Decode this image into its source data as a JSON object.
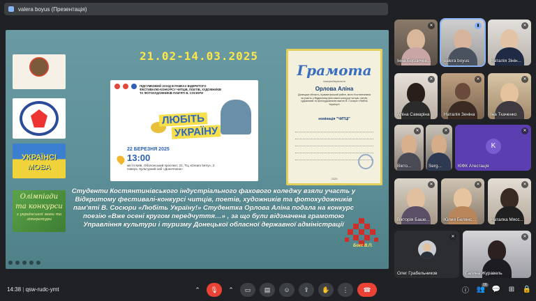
{
  "topbar": {
    "presenter_label": "valera boyus (Презентація)"
  },
  "slide": {
    "date_range": "21.02-14.03.2025",
    "logos": {
      "ukr_line1": "УКРАЇНСІ",
      "ukr_line2": "МОВА",
      "olymp_line1": "Олімпіади",
      "olymp_line2": "та конкурси",
      "olymp_line3": "з української мови та літератури"
    },
    "poster": {
      "header": "ПІДСУМКОВИЙ ЗАХІД В РАМКАХ ВІДКРИТОГО ФЕСТИВАЛЮ-КОНКУРСУ ЧИТЦІВ, ПОЕТІВ, ХУДОЖНИКІВ ТА ФОТОХУДОЖНИКІВ ПАМ'ЯТІ В. СОСЮРИ",
      "title1": "ЛЮБІТЬ",
      "title2": "УКРАЇНУ",
      "date": "22 БЕРЕЗНЯ 2025",
      "time": "13:00",
      "address": "місто Київ, Оболонський проспект, 21, ТЦ «Dream berry», 2 поверх, Культурний хаб «Донеччина»"
    },
    "certificate": {
      "title": "Грамота",
      "awarded": "нагороджується",
      "name": "Орлова Аліна",
      "body": "Донецька область, Краматорський район, місто Костянтинівка за участь у Відкритому фестивалі-конкурсі читців, поетів, художників та фотохудожників пам'яті В. Сосюри «Любіть Україну!»",
      "nomination": "номінація \"ЧИТЦІ\"",
      "year": "2025"
    },
    "main_text": "Студенти Костянтинівського індустріального фахового коледжу взяли участь у Відкритому фестивалі-конкурсі читців, поетів, художників та фотохудожників пам'яті В. Сосюри «Любіть Україну!» Студентка Орлова Аліна подала на конкурс поезію «Вже осені кругом передчуття…» , за що були відзначена грамотою Управління культури і туризму Донецької обласної державної адміністрації",
    "author": "Бокс В.П."
  },
  "participants": [
    {
      "name": "Інна Бердичев...",
      "muted": true
    },
    {
      "name": "valera boyus",
      "muted": false
    },
    {
      "name": "Наталія Зінін...",
      "muted": true
    },
    {
      "name": "Аліна Самаріна",
      "muted": true
    },
    {
      "name": "Наталія Зеніна",
      "muted": true
    },
    {
      "name": "Іна Ткаченко",
      "muted": true
    },
    {
      "name": "Вікто...",
      "muted": true
    },
    {
      "name": "Serg...",
      "muted": true
    },
    {
      "name": "КІФК Атестація",
      "muted": true,
      "initial": "K"
    },
    {
      "name": "Вікторія Баше...",
      "muted": true
    },
    {
      "name": "Юлия Белянс...",
      "muted": true
    },
    {
      "name": "Наталка Мясс...",
      "muted": true
    },
    {
      "name": "Олег Грабельников",
      "muted": true
    },
    {
      "name": "Галина Журавель",
      "muted": true
    }
  ],
  "bottombar": {
    "time": "14:38",
    "meeting_code": "qsw-rudc-ymt",
    "participants_count": "16"
  },
  "colors": {
    "accent": "#8ab4f8",
    "end_call": "#ea4335",
    "background": "#202124"
  }
}
